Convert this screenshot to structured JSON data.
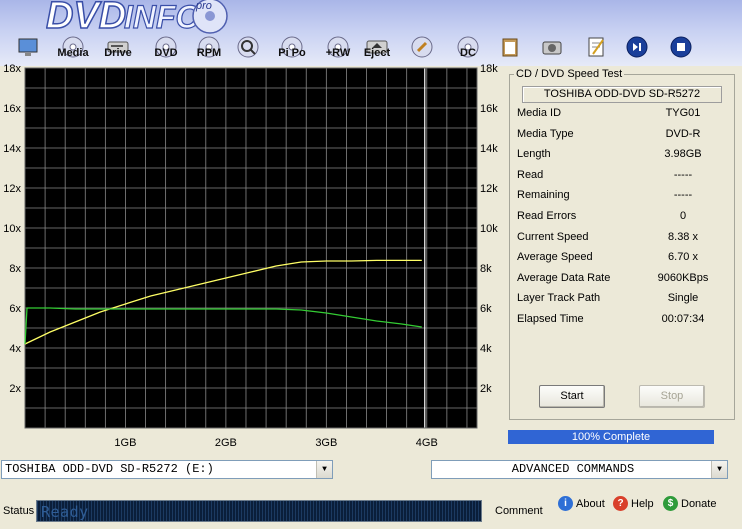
{
  "app": {
    "logo_text": "DVDINFO",
    "logo_badge": "pro"
  },
  "toolbar": [
    {
      "name": "monitor-button",
      "label": "",
      "icon": "monitor-icon"
    },
    {
      "name": "media-button",
      "label": "Media",
      "icon": "disc-icon"
    },
    {
      "name": "drive-button",
      "label": "Drive",
      "icon": "drive-icon"
    },
    {
      "name": "dvd-button",
      "label": "DVD",
      "icon": "disc-icon"
    },
    {
      "name": "rpm-button",
      "label": "RPM",
      "icon": "disc-icon"
    },
    {
      "name": "search-button",
      "label": "",
      "icon": "magnifier-icon"
    },
    {
      "name": "pipo-button",
      "label": "Pi Po",
      "icon": "disc-icon"
    },
    {
      "name": "rw-button",
      "label": "+RW",
      "icon": "disc-icon"
    },
    {
      "name": "eject-button",
      "label": "Eject",
      "icon": "eject-icon"
    },
    {
      "name": "tools-button",
      "label": "",
      "icon": "wrench-icon"
    },
    {
      "name": "dc-button",
      "label": "DC",
      "icon": "disc-icon"
    },
    {
      "name": "clipboard-button",
      "label": "",
      "icon": "clipboard-icon"
    },
    {
      "name": "camera-button",
      "label": "",
      "icon": "camera-icon"
    },
    {
      "name": "notepad-button",
      "label": "",
      "icon": "notepad-icon"
    },
    {
      "name": "play-pause-button",
      "label": "",
      "icon": "play-pause-icon"
    },
    {
      "name": "stop-button",
      "label": "",
      "icon": "stop-icon"
    }
  ],
  "chart_data": {
    "type": "line",
    "xlabel": "",
    "ylabel": "",
    "x_ticks": [
      "1GB",
      "2GB",
      "3GB",
      "4GB"
    ],
    "y_ticks": [
      "2x",
      "4x",
      "6x",
      "8x",
      "10x",
      "12x",
      "14x",
      "16x",
      "18x"
    ],
    "y_ticks_right": [
      "2k",
      "4k",
      "6k",
      "8k",
      "10k",
      "12k",
      "14k",
      "16k",
      "18k"
    ],
    "xlim": [
      0,
      4.5
    ],
    "ylim": [
      0,
      18
    ],
    "marker_x": 3.98,
    "grid": true,
    "background": "#000000",
    "series": [
      {
        "color": "#ffff66",
        "x": [
          0,
          0.25,
          0.5,
          0.75,
          1.0,
          1.25,
          1.5,
          1.75,
          2.0,
          2.25,
          2.5,
          2.75,
          3.0,
          3.25,
          3.5,
          3.75,
          3.95
        ],
        "y": [
          4.2,
          4.8,
          5.3,
          5.8,
          6.2,
          6.6,
          6.9,
          7.2,
          7.5,
          7.8,
          8.1,
          8.3,
          8.35,
          8.35,
          8.38,
          8.38,
          8.38
        ]
      },
      {
        "color": "#33cc33",
        "x": [
          0,
          0.02,
          0.25,
          0.5,
          1.0,
          1.5,
          2.0,
          2.5,
          2.75,
          3.0,
          3.25,
          3.5,
          3.75,
          3.95
        ],
        "y": [
          4.2,
          6.0,
          6.0,
          5.95,
          5.95,
          5.95,
          5.95,
          5.95,
          5.9,
          5.75,
          5.55,
          5.35,
          5.2,
          5.05
        ]
      }
    ]
  },
  "panel": {
    "title": "CD / DVD Speed Test",
    "drive": "TOSHIBA ODD-DVD SD-R5272",
    "rows": [
      {
        "label": "Media ID",
        "value": "TYG01"
      },
      {
        "label": "Media Type",
        "value": "DVD-R"
      },
      {
        "label": "Length",
        "value": "3.98GB"
      },
      {
        "label": "Read",
        "value": "-----"
      },
      {
        "label": "Remaining",
        "value": "-----"
      },
      {
        "label": "Read Errors",
        "value": "0"
      },
      {
        "label": "Current Speed",
        "value": "8.38 x"
      },
      {
        "label": "Average Speed",
        "value": "6.70 x"
      },
      {
        "label": "Average Data Rate",
        "value": "9060KBps"
      },
      {
        "label": "Layer Track Path",
        "value": "Single"
      },
      {
        "label": "Elapsed Time",
        "value": "00:07:34"
      }
    ],
    "start_label": "Start",
    "stop_label": "Stop"
  },
  "progress": {
    "label": "100% Complete",
    "fraction": 1.0
  },
  "drive_select": {
    "value": "TOSHIBA ODD-DVD SD-R5272 (E:)"
  },
  "advanced_select": {
    "value": "ADVANCED COMMANDS"
  },
  "status": {
    "label": "Status",
    "text": "Ready",
    "comment_label": "Comment"
  },
  "links": {
    "about": "About",
    "help": "Help",
    "donate": "Donate"
  },
  "colors": {
    "progress": "#3065d4",
    "about_icon": "#2e6fd6",
    "help_icon": "#d9402b",
    "donate_icon": "#2f9b3a"
  }
}
